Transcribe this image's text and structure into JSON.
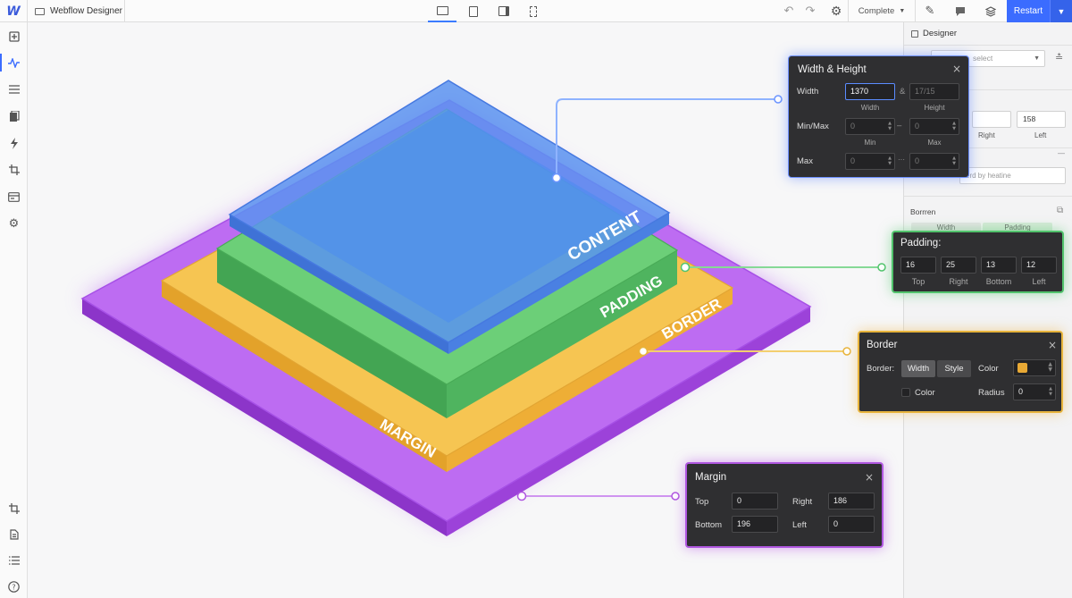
{
  "app": {
    "logo": "W",
    "doc_title": "Webflow Designer"
  },
  "toolbar": {
    "undo": "↶",
    "redo": "↷",
    "status": "Complete",
    "restart": "Restart"
  },
  "right_panel": {
    "title": "Designer",
    "select_placeholder": "select",
    "right_value": "158",
    "right_label": "Right",
    "left_label": "Left",
    "search_placeholder": "erd by heatine",
    "section": "Borrren",
    "tab1": "Width",
    "tab2": "Padding"
  },
  "layers": {
    "content": "CONTENT",
    "padding": "PADDING",
    "border": "BORDER",
    "margin": "MARGIN"
  },
  "width_height": {
    "title": "Width & Height",
    "width_label": "Width",
    "width_value": "1370",
    "amp": "&",
    "height_value": "17/15",
    "sub_width": "Width",
    "sub_height": "Height",
    "minmax_label": "Min/Max",
    "min_value": "0",
    "max_value": "0",
    "sub_min": "Min",
    "sub_max": "Max",
    "max_label": "Max",
    "max_min_value": "0",
    "max_max_value": "0",
    "dash": "–",
    "dots": "···"
  },
  "padding": {
    "title": "Padding:",
    "top": "16",
    "right": "25",
    "bottom": "13",
    "left": "12",
    "top_label": "Top",
    "right_label": "Right",
    "bottom_label": "Bottom",
    "left_label": "Left"
  },
  "border": {
    "title": "Border",
    "border_label": "Border:",
    "width_btn": "Width",
    "style_btn": "Style",
    "color_label": "Color",
    "color_hex": "#e8a935",
    "color_checkbox_label": "Color",
    "radius_label": "Radius",
    "radius_value": "0"
  },
  "margin": {
    "title": "Margin",
    "top_label": "Top",
    "top_value": "0",
    "right_label": "Right",
    "right_value": "186",
    "bottom_label": "Bottom",
    "bottom_value": "196",
    "left_label": "Left",
    "left_value": "0"
  },
  "colors": {
    "accent": "#3b6cff",
    "content": "#4f8ff0",
    "padding": "#5cc46a",
    "border": "#f4be45",
    "margin": "#b75ff0"
  }
}
